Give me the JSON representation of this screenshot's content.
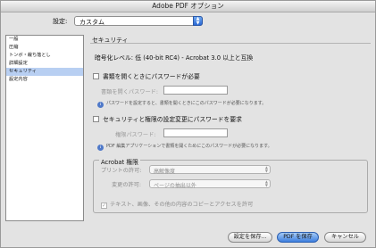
{
  "window": {
    "title": "Adobe PDF オプション"
  },
  "preset": {
    "label": "設定:",
    "value": "カスタム"
  },
  "sidebar": {
    "items": [
      {
        "label": "一般"
      },
      {
        "label": "圧縮"
      },
      {
        "label": "トンボ・裁ち落とし"
      },
      {
        "label": "詳細設定"
      },
      {
        "label": "セキュリティ"
      },
      {
        "label": "設定内容"
      }
    ],
    "selected_index": 4
  },
  "panel": {
    "title": "セキュリティ",
    "encryption_level": "暗号化レベル:  低 (40-bit RC4) - Acrobat 3.0 以上と互換",
    "open_password": {
      "checkbox_label": "書類を開くときにパスワードが必要",
      "field_label": "書類を開くパスワード:",
      "field_value": "",
      "note": "パスワードを設定すると、書類を開くときにこのパスワードが必要になります。"
    },
    "permissions_password": {
      "checkbox_label": "セキュリティと権限の設定変更にパスワードを要求",
      "field_label": "権限パスワード:",
      "field_value": "",
      "note": "PDF 編集アプリケーションで書類を開くためにこのパスワードが必要になります。"
    },
    "acrobat_permissions": {
      "group_title": "Acrobat 権限",
      "print_label": "プリントの許可:",
      "print_value": "高解像度",
      "change_label": "変更の許可:",
      "change_value": "ページの抽出以外",
      "copy_label": "テキスト、画像、その他の内容のコピーとアクセスを許可"
    }
  },
  "buttons": {
    "save_settings": "設定を保存...",
    "save_pdf": "PDF を保存",
    "cancel": "キャンセル"
  },
  "colors": {
    "accent": "#3d7fdf",
    "selection": "#b8cff2"
  }
}
